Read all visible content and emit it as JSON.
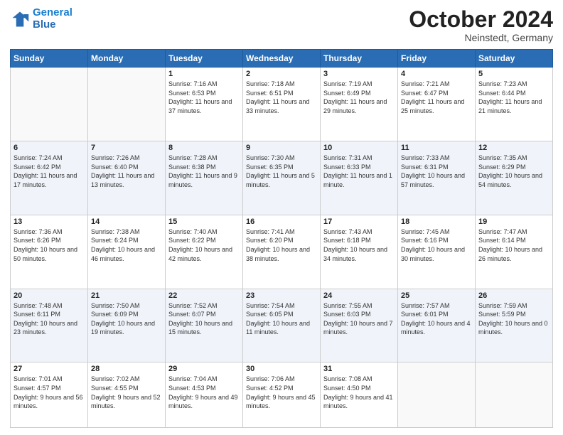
{
  "header": {
    "logo_line1": "General",
    "logo_line2": "Blue",
    "month": "October 2024",
    "location": "Neinstedt, Germany"
  },
  "weekdays": [
    "Sunday",
    "Monday",
    "Tuesday",
    "Wednesday",
    "Thursday",
    "Friday",
    "Saturday"
  ],
  "weeks": [
    [
      {
        "day": "",
        "info": ""
      },
      {
        "day": "",
        "info": ""
      },
      {
        "day": "1",
        "info": "Sunrise: 7:16 AM\nSunset: 6:53 PM\nDaylight: 11 hours and 37 minutes."
      },
      {
        "day": "2",
        "info": "Sunrise: 7:18 AM\nSunset: 6:51 PM\nDaylight: 11 hours and 33 minutes."
      },
      {
        "day": "3",
        "info": "Sunrise: 7:19 AM\nSunset: 6:49 PM\nDaylight: 11 hours and 29 minutes."
      },
      {
        "day": "4",
        "info": "Sunrise: 7:21 AM\nSunset: 6:47 PM\nDaylight: 11 hours and 25 minutes."
      },
      {
        "day": "5",
        "info": "Sunrise: 7:23 AM\nSunset: 6:44 PM\nDaylight: 11 hours and 21 minutes."
      }
    ],
    [
      {
        "day": "6",
        "info": "Sunrise: 7:24 AM\nSunset: 6:42 PM\nDaylight: 11 hours and 17 minutes."
      },
      {
        "day": "7",
        "info": "Sunrise: 7:26 AM\nSunset: 6:40 PM\nDaylight: 11 hours and 13 minutes."
      },
      {
        "day": "8",
        "info": "Sunrise: 7:28 AM\nSunset: 6:38 PM\nDaylight: 11 hours and 9 minutes."
      },
      {
        "day": "9",
        "info": "Sunrise: 7:30 AM\nSunset: 6:35 PM\nDaylight: 11 hours and 5 minutes."
      },
      {
        "day": "10",
        "info": "Sunrise: 7:31 AM\nSunset: 6:33 PM\nDaylight: 11 hours and 1 minute."
      },
      {
        "day": "11",
        "info": "Sunrise: 7:33 AM\nSunset: 6:31 PM\nDaylight: 10 hours and 57 minutes."
      },
      {
        "day": "12",
        "info": "Sunrise: 7:35 AM\nSunset: 6:29 PM\nDaylight: 10 hours and 54 minutes."
      }
    ],
    [
      {
        "day": "13",
        "info": "Sunrise: 7:36 AM\nSunset: 6:26 PM\nDaylight: 10 hours and 50 minutes."
      },
      {
        "day": "14",
        "info": "Sunrise: 7:38 AM\nSunset: 6:24 PM\nDaylight: 10 hours and 46 minutes."
      },
      {
        "day": "15",
        "info": "Sunrise: 7:40 AM\nSunset: 6:22 PM\nDaylight: 10 hours and 42 minutes."
      },
      {
        "day": "16",
        "info": "Sunrise: 7:41 AM\nSunset: 6:20 PM\nDaylight: 10 hours and 38 minutes."
      },
      {
        "day": "17",
        "info": "Sunrise: 7:43 AM\nSunset: 6:18 PM\nDaylight: 10 hours and 34 minutes."
      },
      {
        "day": "18",
        "info": "Sunrise: 7:45 AM\nSunset: 6:16 PM\nDaylight: 10 hours and 30 minutes."
      },
      {
        "day": "19",
        "info": "Sunrise: 7:47 AM\nSunset: 6:14 PM\nDaylight: 10 hours and 26 minutes."
      }
    ],
    [
      {
        "day": "20",
        "info": "Sunrise: 7:48 AM\nSunset: 6:11 PM\nDaylight: 10 hours and 23 minutes."
      },
      {
        "day": "21",
        "info": "Sunrise: 7:50 AM\nSunset: 6:09 PM\nDaylight: 10 hours and 19 minutes."
      },
      {
        "day": "22",
        "info": "Sunrise: 7:52 AM\nSunset: 6:07 PM\nDaylight: 10 hours and 15 minutes."
      },
      {
        "day": "23",
        "info": "Sunrise: 7:54 AM\nSunset: 6:05 PM\nDaylight: 10 hours and 11 minutes."
      },
      {
        "day": "24",
        "info": "Sunrise: 7:55 AM\nSunset: 6:03 PM\nDaylight: 10 hours and 7 minutes."
      },
      {
        "day": "25",
        "info": "Sunrise: 7:57 AM\nSunset: 6:01 PM\nDaylight: 10 hours and 4 minutes."
      },
      {
        "day": "26",
        "info": "Sunrise: 7:59 AM\nSunset: 5:59 PM\nDaylight: 10 hours and 0 minutes."
      }
    ],
    [
      {
        "day": "27",
        "info": "Sunrise: 7:01 AM\nSunset: 4:57 PM\nDaylight: 9 hours and 56 minutes."
      },
      {
        "day": "28",
        "info": "Sunrise: 7:02 AM\nSunset: 4:55 PM\nDaylight: 9 hours and 52 minutes."
      },
      {
        "day": "29",
        "info": "Sunrise: 7:04 AM\nSunset: 4:53 PM\nDaylight: 9 hours and 49 minutes."
      },
      {
        "day": "30",
        "info": "Sunrise: 7:06 AM\nSunset: 4:52 PM\nDaylight: 9 hours and 45 minutes."
      },
      {
        "day": "31",
        "info": "Sunrise: 7:08 AM\nSunset: 4:50 PM\nDaylight: 9 hours and 41 minutes."
      },
      {
        "day": "",
        "info": ""
      },
      {
        "day": "",
        "info": ""
      }
    ]
  ]
}
